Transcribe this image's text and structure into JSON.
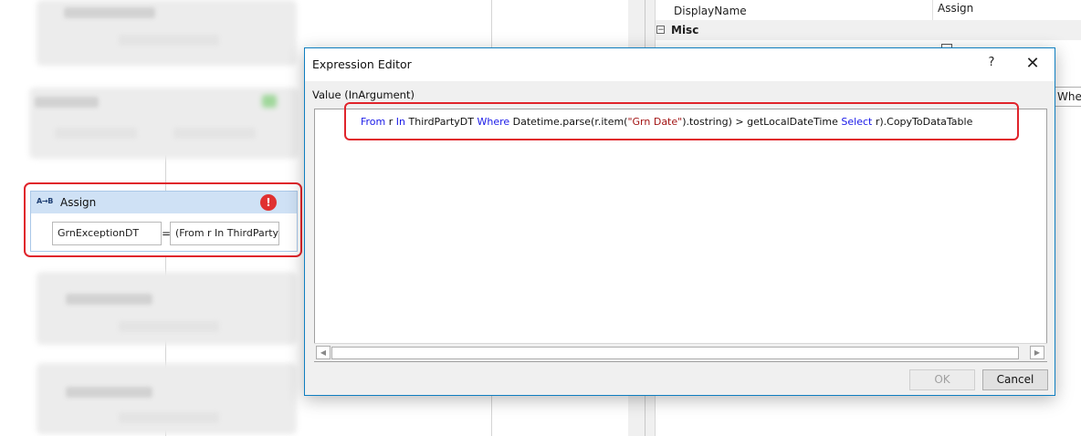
{
  "designer": {
    "assign": {
      "title": "Assign",
      "icon_text": "A→B",
      "error_icon": "!",
      "to_value": "GrnExceptionDT",
      "equals": "=",
      "value_preview": "(From r In ThirdParty"
    }
  },
  "property_grid": {
    "display_name_label": "DisplayName",
    "display_name_value": "Assign",
    "category_misc": "Misc",
    "expander_symbol": "−",
    "partial_value": "Whe"
  },
  "dialog": {
    "title": "Expression Editor",
    "help_icon": "?",
    "close_icon": "✕",
    "argument_label": "Value (InArgument)",
    "expression": {
      "kw_from": "From",
      "t1": " r ",
      "kw_in": "In",
      "t2": " ThirdPartyDT ",
      "kw_where": "Where",
      "t3": " Datetime.parse(r.item(",
      "str_col": "\"Grn Date\"",
      "t4": ").tostring) > getLocalDateTime ",
      "kw_select": "Select",
      "t5": " r).CopyToDataTable"
    },
    "ok_label": "OK",
    "cancel_label": "Cancel",
    "scroll_left": "◀",
    "scroll_right": "▶"
  },
  "colors": {
    "highlight_red": "#e0242b",
    "dialog_border": "#0f7ec0",
    "keyword_blue": "#1a1ae8",
    "assign_header": "#cfe1f5",
    "error_red": "#e03131"
  }
}
